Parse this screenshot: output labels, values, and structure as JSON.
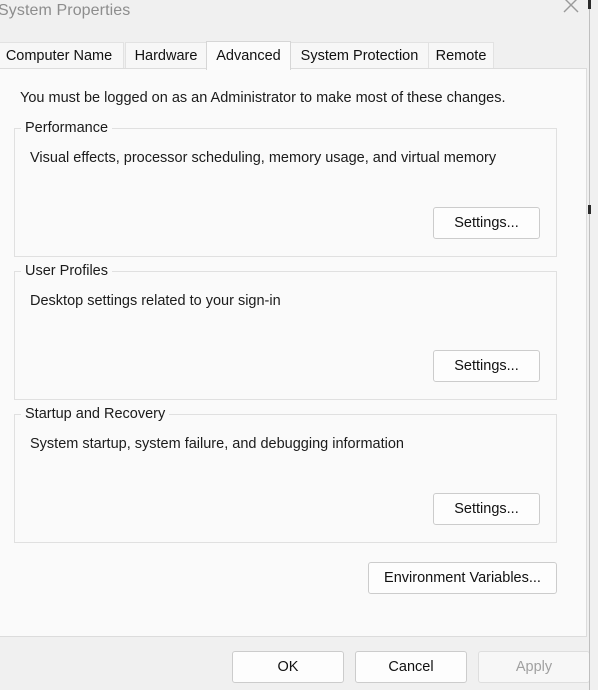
{
  "window": {
    "title": "System Properties",
    "close_icon": "close-icon"
  },
  "tabs": [
    {
      "label": "Computer Name",
      "selected": false
    },
    {
      "label": "Hardware",
      "selected": false
    },
    {
      "label": "Advanced",
      "selected": true
    },
    {
      "label": "System Protection",
      "selected": false
    },
    {
      "label": "Remote",
      "selected": false
    }
  ],
  "content": {
    "admin_note": "You must be logged on as an Administrator to make most of these changes.",
    "groups": [
      {
        "label": "Performance",
        "description": "Visual effects, processor scheduling, memory usage, and virtual memory",
        "button_label": "Settings..."
      },
      {
        "label": "User Profiles",
        "description": "Desktop settings related to your sign-in",
        "button_label": "Settings..."
      },
      {
        "label": "Startup and Recovery",
        "description": "System startup, system failure, and debugging information",
        "button_label": "Settings..."
      }
    ],
    "environment_variables_label": "Environment Variables..."
  },
  "footer": {
    "ok_label": "OK",
    "cancel_label": "Cancel",
    "apply_label": "Apply",
    "apply_enabled": false
  },
  "colors": {
    "window_bg": "#f0f0f0",
    "panel_bg": "#fafafa",
    "title_text": "#8d8d8d",
    "body_text": "#1b1b1b",
    "disabled_text": "#a0a0a0",
    "border": "#e0e0e0"
  }
}
